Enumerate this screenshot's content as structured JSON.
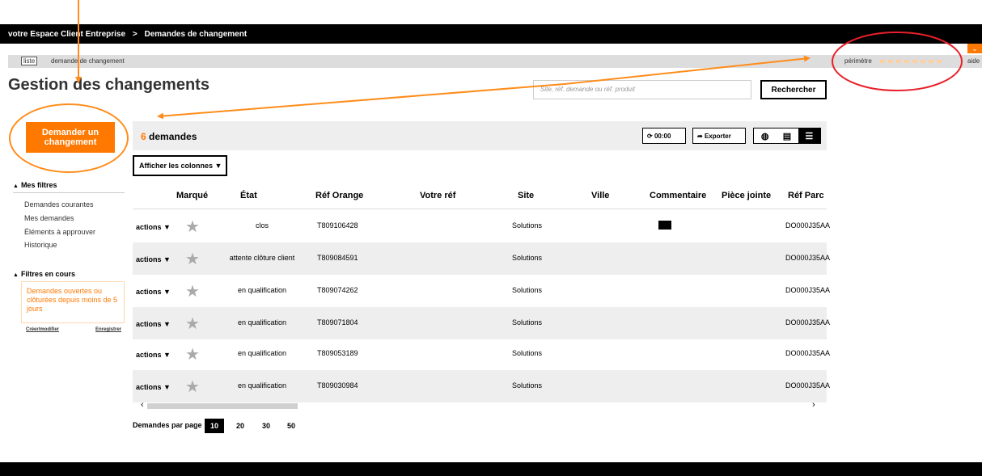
{
  "breadcrumb": {
    "home": "votre Espace Client Entreprise",
    "separator": ">",
    "current": "Demandes de changement"
  },
  "subnav": {
    "tab_list": "liste",
    "tab_change": "demande de changement",
    "perimeter": "périmètre",
    "help": "aide"
  },
  "page_title": "Gestion des changements",
  "search": {
    "placeholder": "Site, réf. demande ou réf. produit",
    "button": "Rechercher"
  },
  "cta": {
    "line1": "Demander un",
    "line2": "changement"
  },
  "filters": {
    "title": "Mes filtres",
    "items": [
      "Demandes courantes",
      "Mes demandes",
      "Éléments à approuver",
      "Historique"
    ],
    "current_title": "Filtres en cours",
    "current_value": "Demandes ouvertes ou clôturées depuis moins de 5 jours",
    "create_link": "Créer/modifier",
    "save_link": "Enregistrer"
  },
  "toolbar": {
    "count": "6",
    "count_label": "demandes",
    "refresh": "00:00",
    "export": "Exporter",
    "columns_button": "Afficher les colonnes"
  },
  "table": {
    "headers": [
      "Marqué",
      "État",
      "Réf Orange",
      "Votre réf",
      "Site",
      "Ville",
      "Commentaire",
      "Pièce jointe",
      "Réf Parc"
    ],
    "action_label": "actions",
    "rows": [
      {
        "etat": "clos",
        "ref_orange": "T809106428",
        "site": "Solutions",
        "comment": true,
        "ref_parc": "DO000J35AA"
      },
      {
        "etat": "attente clôture client",
        "ref_orange": "T809084591",
        "site": "Solutions",
        "comment": false,
        "ref_parc": "DO000J35AA"
      },
      {
        "etat": "en qualification",
        "ref_orange": "T809074262",
        "site": "Solutions",
        "comment": false,
        "ref_parc": "DO000J35AA"
      },
      {
        "etat": "en qualification",
        "ref_orange": "T809071804",
        "site": "Solutions",
        "comment": false,
        "ref_parc": "DO000J35AA"
      },
      {
        "etat": "en qualification",
        "ref_orange": "T809053189",
        "site": "Solutions",
        "comment": false,
        "ref_parc": "DO000J35AA"
      },
      {
        "etat": "en qualification",
        "ref_orange": "T809030984",
        "site": "Solutions",
        "comment": false,
        "ref_parc": "DO000J35AA"
      }
    ]
  },
  "pagination": {
    "label": "Demandes par page",
    "options": [
      "10",
      "20",
      "30",
      "50"
    ],
    "selected": "10"
  },
  "colors": {
    "accent": "#ff7900",
    "annotation_red": "#e8202a",
    "annotation_orange": "#ff8c1a"
  }
}
